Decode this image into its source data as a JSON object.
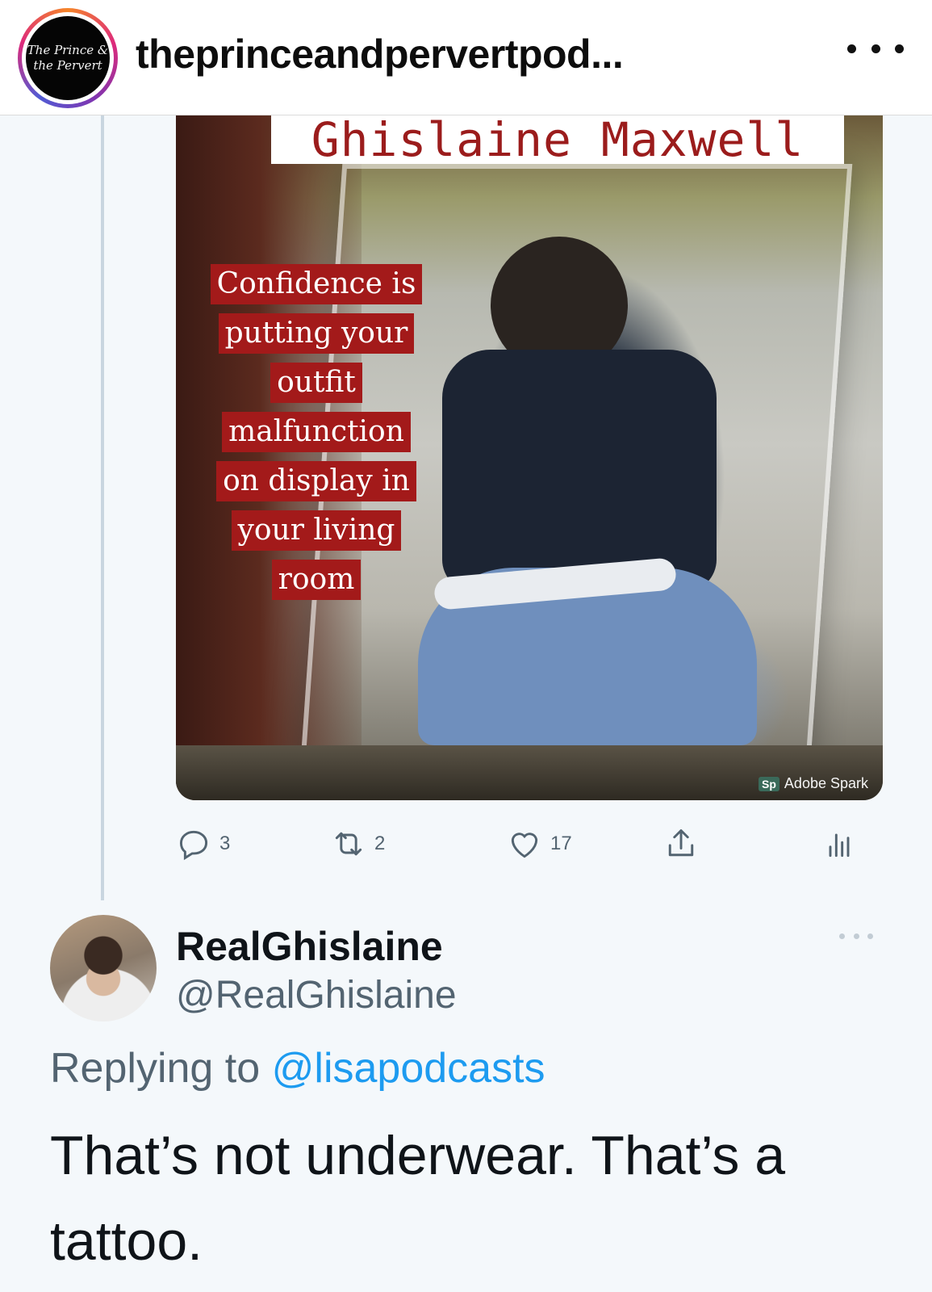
{
  "instagram": {
    "avatar_line1": "The Prince &",
    "avatar_line2": "the Pervert",
    "username": "theprinceandpervertpod...",
    "more_icon": "ellipsis-icon"
  },
  "tweet": {
    "media": {
      "title": "Ghislaine Maxwell",
      "caption_lines": [
        "Confidence is",
        "putting your",
        "outfit",
        "malfunction",
        "on display in",
        "your living",
        "room"
      ],
      "watermark_badge": "Sp",
      "watermark_text": "Adobe Spark"
    },
    "actions": {
      "replies": "3",
      "retweets": "2",
      "likes": "17"
    }
  },
  "reply": {
    "display_name": "RealGhislaine",
    "handle": "@RealGhislaine",
    "replying_prefix": "Replying to ",
    "replying_mention": "@lisapodcasts",
    "text": "That’s not underwear. That’s a tattoo."
  },
  "colors": {
    "link_blue": "#1d9bf0",
    "caption_red": "#a31a1a",
    "muted_gray": "#536471",
    "tweet_background": "#f4f8fb"
  }
}
